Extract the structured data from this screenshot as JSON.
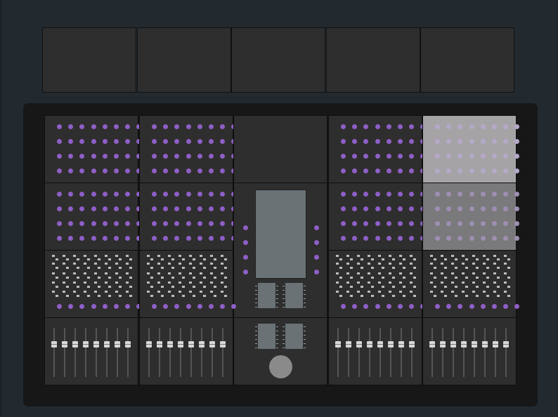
{
  "app": {
    "title": ""
  },
  "colors": {
    "background": "#222a30",
    "deck": "#171717",
    "module": "#2e2e2e",
    "module_highlight": "#a5a3a6",
    "module_dimmed": "#7a797b",
    "led": "#8e5fc6",
    "led_on_highlight": "#b6a8c8",
    "led_on_dimmed": "#9e8fb2",
    "screen": "#6a7276",
    "fader_cap": "#d8d8d8",
    "jog_wheel": "#8a8a8a"
  },
  "icons": {
    "led": "led-dot",
    "jog": "jog-wheel"
  },
  "top_panels": [
    {
      "id": "top-panel-1"
    },
    {
      "id": "top-panel-2"
    },
    {
      "id": "top-panel-3"
    },
    {
      "id": "top-panel-4"
    },
    {
      "id": "top-panel-5"
    }
  ],
  "modules": [
    {
      "id": "led-module-r1-c1",
      "type": "led-grid",
      "state": "normal"
    },
    {
      "id": "led-module-r1-c2",
      "type": "led-grid",
      "state": "normal"
    },
    {
      "id": "blank-module-r1-c3",
      "type": "blank",
      "state": "normal"
    },
    {
      "id": "led-module-r1-c4",
      "type": "led-grid",
      "state": "normal"
    },
    {
      "id": "led-module-r1-c5",
      "type": "led-grid",
      "state": "highlighted"
    },
    {
      "id": "led-module-r2-c1",
      "type": "led-grid",
      "state": "normal"
    },
    {
      "id": "led-module-r2-c2",
      "type": "led-grid",
      "state": "normal"
    },
    {
      "id": "center-screen-module",
      "type": "center-screen",
      "state": "normal"
    },
    {
      "id": "led-module-r2-c4",
      "type": "led-grid",
      "state": "normal"
    },
    {
      "id": "led-module-r2-c5",
      "type": "led-grid",
      "state": "dimmed"
    },
    {
      "id": "button-module-c1",
      "type": "button-strip",
      "state": "normal"
    },
    {
      "id": "button-module-c2",
      "type": "button-strip",
      "state": "normal"
    },
    {
      "id": "button-module-c4",
      "type": "button-strip",
      "state": "normal"
    },
    {
      "id": "button-module-c5",
      "type": "button-strip",
      "state": "normal"
    },
    {
      "id": "fader-module-c1",
      "type": "fader-bank",
      "state": "normal"
    },
    {
      "id": "fader-module-c2",
      "type": "fader-bank",
      "state": "normal"
    },
    {
      "id": "center-jog-module",
      "type": "jog-panel",
      "state": "normal"
    },
    {
      "id": "fader-module-c4",
      "type": "fader-bank",
      "state": "normal"
    },
    {
      "id": "fader-module-c5",
      "type": "fader-bank",
      "state": "normal"
    }
  ]
}
